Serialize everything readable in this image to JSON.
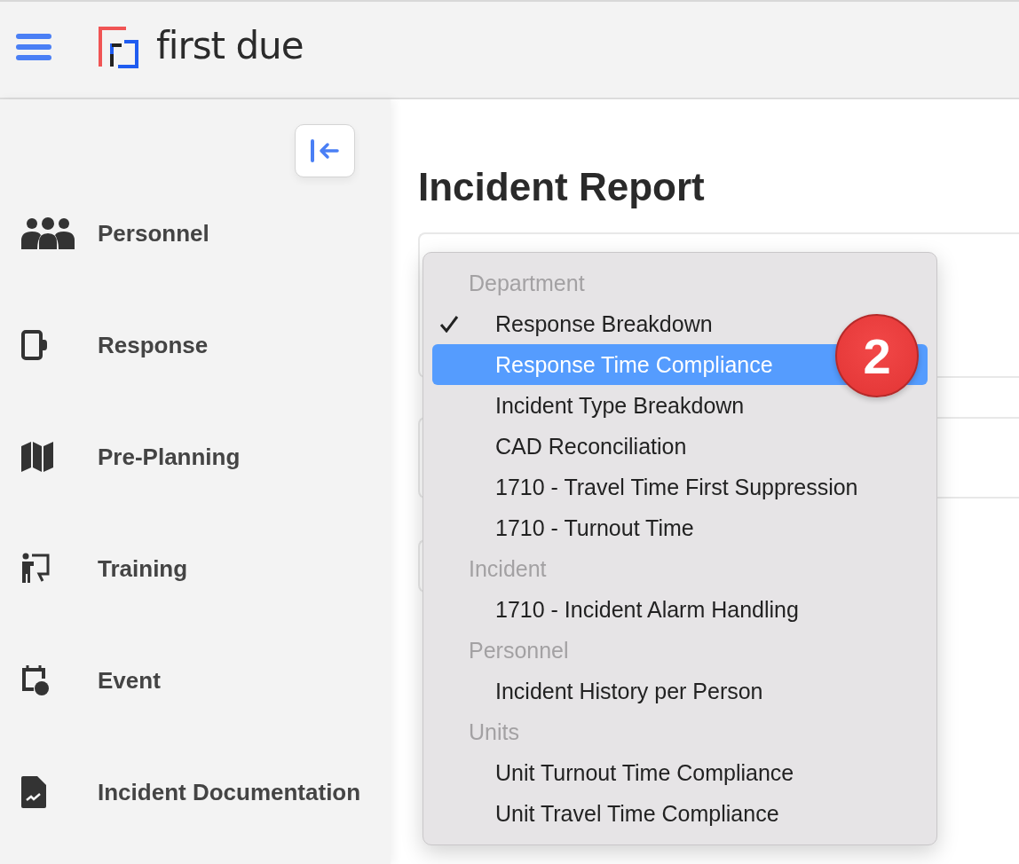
{
  "header": {
    "logo_text": "first due"
  },
  "sidebar": {
    "items": [
      {
        "label": "Personnel"
      },
      {
        "label": "Response"
      },
      {
        "label": "Pre-Planning"
      },
      {
        "label": "Training"
      },
      {
        "label": "Event"
      },
      {
        "label": "Incident Documentation"
      }
    ]
  },
  "page": {
    "title": "Incident Report"
  },
  "report_menu": {
    "groups": [
      {
        "header": "Department",
        "items": [
          {
            "label": "Response Breakdown",
            "checked": true,
            "selected": false
          },
          {
            "label": "Response Time Compliance",
            "checked": false,
            "selected": true
          },
          {
            "label": "Incident Type Breakdown",
            "checked": false,
            "selected": false
          },
          {
            "label": "CAD Reconciliation",
            "checked": false,
            "selected": false
          },
          {
            "label": "1710 - Travel Time First Suppression",
            "checked": false,
            "selected": false
          },
          {
            "label": "1710 - Turnout Time",
            "checked": false,
            "selected": false
          }
        ]
      },
      {
        "header": "Incident",
        "items": [
          {
            "label": "1710 - Incident Alarm Handling",
            "checked": false,
            "selected": false
          }
        ]
      },
      {
        "header": "Personnel",
        "items": [
          {
            "label": "Incident History per Person",
            "checked": false,
            "selected": false
          }
        ]
      },
      {
        "header": "Units",
        "items": [
          {
            "label": "Unit Turnout Time Compliance",
            "checked": false,
            "selected": false
          },
          {
            "label": "Unit Travel Time Compliance",
            "checked": false,
            "selected": false
          }
        ]
      }
    ]
  },
  "step_badge": "2"
}
